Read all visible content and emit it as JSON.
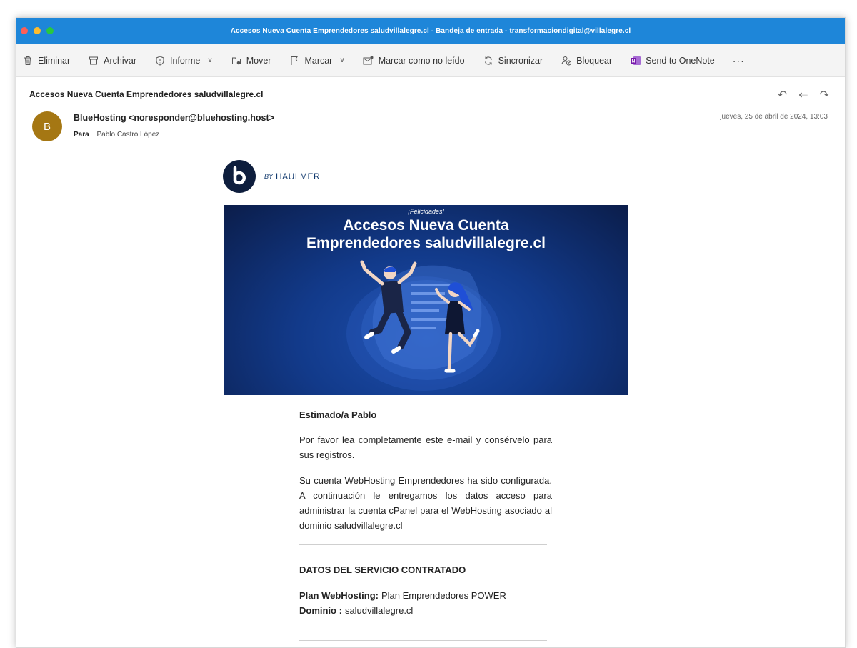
{
  "window": {
    "title": "Accesos Nueva Cuenta Emprendedores saludvillalegre.cl - Bandeja de entrada - transformaciondigital@villalegre.cl"
  },
  "toolbar": {
    "delete": "Eliminar",
    "archive": "Archivar",
    "report": "Informe",
    "move": "Mover",
    "flag": "Marcar",
    "mark_unread": "Marcar como no leído",
    "sync": "Sincronizar",
    "block": "Bloquear",
    "onenote": "Send to OneNote",
    "more": "···"
  },
  "message": {
    "subject": "Accesos Nueva Cuenta Emprendedores saludvillalegre.cl",
    "avatar_initial": "B",
    "sender": "BlueHosting <noresponder@bluehosting.host>",
    "to_label": "Para",
    "to_name": "Pablo Castro López",
    "date": "jueves, 25 de abril de 2024, 13:03"
  },
  "email": {
    "logo_by": "BY",
    "logo_brand": "HAULMER",
    "banner_kicker": "¡Felicidades!",
    "banner_line1": "Accesos Nueva Cuenta",
    "banner_line2": "Emprendedores saludvillalegre.cl",
    "greeting": "Estimado/a Pablo",
    "paragraph1": "Por favor lea completamente este e-mail y consérvelo para sus registros.",
    "paragraph2": "Su cuenta WebHosting Emprendedores ha sido configurada. A continuación le entregamos los datos acceso para administrar la cuenta cPanel para el WebHosting asociado al dominio saludvillalegre.cl",
    "section_title": "DATOS DEL SERVICIO CONTRATADO",
    "plan_label": "Plan WebHosting:",
    "plan_value": "Plan Emprendedores POWER",
    "domain_label": "Dominio :",
    "domain_value": "saludvillalegre.cl"
  },
  "colors": {
    "titlebar": "#1e86d9",
    "avatar": "#a57713",
    "banner": "#123a8a",
    "brand": "#0e1e3d"
  }
}
